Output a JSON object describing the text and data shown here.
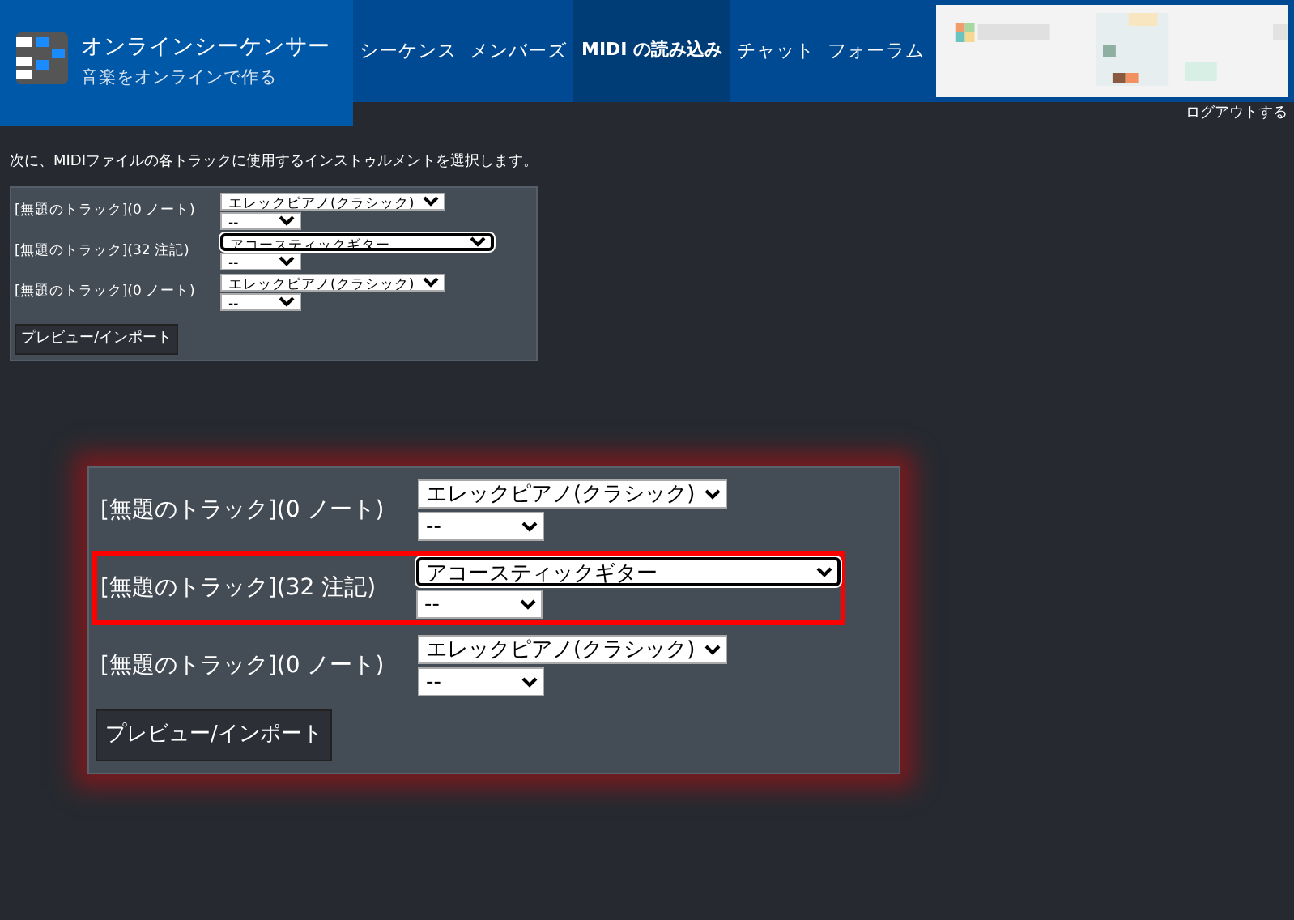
{
  "app": {
    "title": "オンラインシーケンサー",
    "subtitle": "音楽をオンラインで作る"
  },
  "nav": [
    {
      "label": "シーケンス",
      "selected": false
    },
    {
      "label": "メンバーズ",
      "selected": false
    },
    {
      "label": "MIDI の読み込み",
      "selected": true
    },
    {
      "label": "チャット",
      "selected": false
    },
    {
      "label": "フォーラム",
      "selected": false
    }
  ],
  "user_bar": {
    "logout": "ログアウトする"
  },
  "instruction": "次に、MIDIファイルの各トラックに使用するインストゥルメントを選択します。",
  "tracks": [
    {
      "label": "[無題のトラック](0 ノート)",
      "instrument": "エレックピアノ(クラシック)",
      "option": "--",
      "focused": false
    },
    {
      "label": "[無題のトラック](32 注記)",
      "instrument": "アコースティックギター",
      "option": "--",
      "focused": true
    },
    {
      "label": "[無題のトラック](0 ノート)",
      "instrument": "エレックピアノ(クラシック)",
      "option": "--",
      "focused": false
    }
  ],
  "button": "プレビュー/インポート",
  "callout": {
    "tracks": [
      {
        "label": "[無題のトラック](0 ノート)",
        "instrument": "エレックピアノ(クラシック)",
        "option": "--",
        "focused": false,
        "highlighted": false
      },
      {
        "label": "[無題のトラック](32 注記)",
        "instrument": "アコースティックギター",
        "option": "--",
        "focused": true,
        "highlighted": true
      },
      {
        "label": "[無題のトラック](0 ノート)",
        "instrument": "エレックピアノ(クラシック)",
        "option": "--",
        "focused": false,
        "highlighted": false
      }
    ],
    "button": "プレビュー/インポート"
  }
}
